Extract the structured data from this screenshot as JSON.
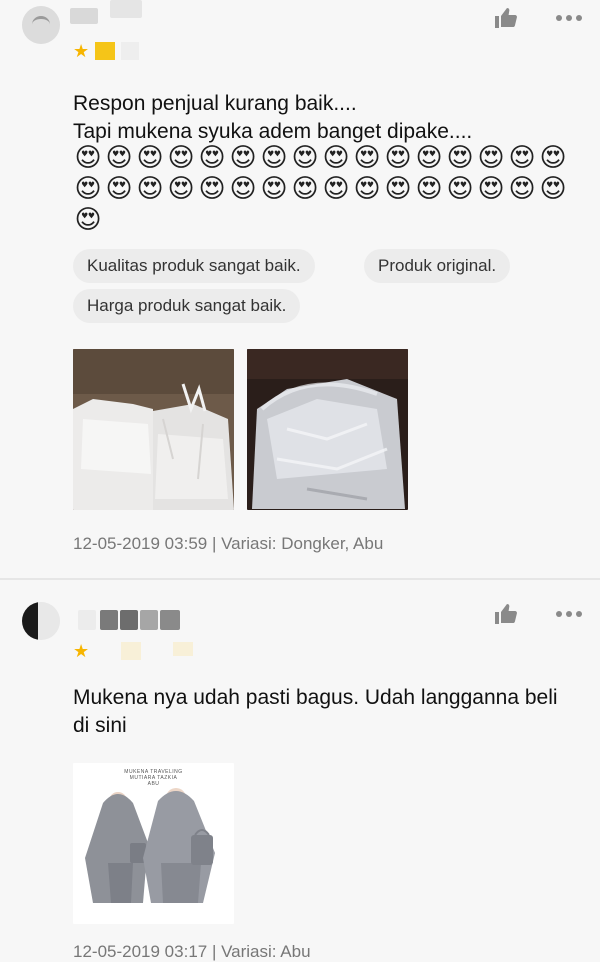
{
  "reviews": [
    {
      "comment": "Respon penjual kurang baik....\nTapi mukena syuka adem banget dipake....",
      "emoji_char": "😍",
      "emoji_count": 33,
      "tags": [
        "Kualitas produk sangat baik.",
        "Produk original.",
        "Harga produk sangat baik."
      ],
      "meta": "12-05-2019 03:59 | Variasi: Dongker, Abu",
      "like_icon": "thumbs-up-icon",
      "more_icon": "more-dots-icon"
    },
    {
      "comment": "Mukena nya udah pasti bagus. Udah langganna beli di sini",
      "image_caption": "MUKENA TRAVELING\nMUTIARA TAZKIA\nABU",
      "meta": "12-05-2019 03:17 | Variasi: Abu",
      "like_icon": "thumbs-up-icon",
      "more_icon": "more-dots-icon"
    }
  ],
  "colors": {
    "star": "#f7b500",
    "icon": "#8a8a8a",
    "meta": "#777777",
    "tag_bg": "#ececec"
  }
}
